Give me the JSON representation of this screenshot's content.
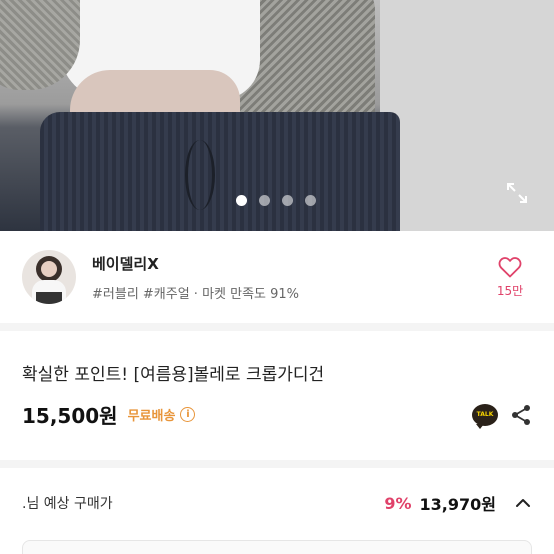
{
  "hero": {
    "image_alt": "product photo",
    "slides": 4,
    "active_slide": 1,
    "expand_icon": "expand-icon"
  },
  "seller": {
    "name": "베이델리X",
    "tags": "#러블리 #캐주얼 · 마켓 만족도 91%",
    "like_count": "15만",
    "like_icon": "heart-icon",
    "colors": {
      "like": "#e0426a"
    }
  },
  "product": {
    "title": "확실한 포인트! [여름용]볼레로 크롭가디건",
    "price": "15,500원",
    "shipping": "무료배송",
    "shipping_info_icon": "i",
    "talk_badge": "TALK",
    "colors": {
      "shipping": "#e8953a"
    }
  },
  "expected_price": {
    "label": ".님 예상 구매가",
    "discount": "9%",
    "price": "13,970원",
    "toggle_icon": "chevron-up-icon"
  }
}
